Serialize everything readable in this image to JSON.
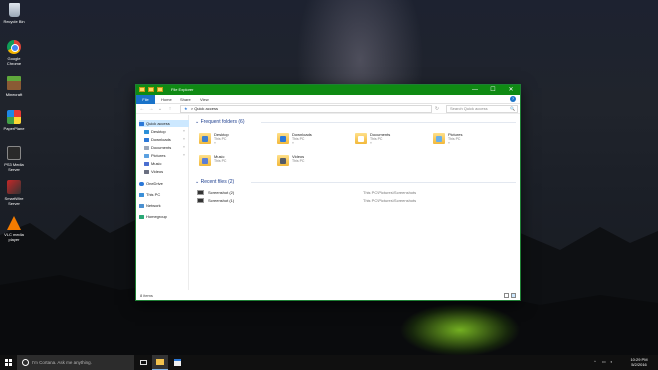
{
  "desktop": {
    "icons": [
      {
        "label": "Recycle Bin",
        "icon": "recycle-bin-icon"
      },
      {
        "label": "Google Chrome",
        "icon": "chrome-icon"
      },
      {
        "label": "Minecraft",
        "icon": "minecraft-icon"
      },
      {
        "label": "PaperPlane",
        "icon": "paperplane-icon"
      },
      {
        "label": "PS3 Media Server",
        "icon": "ps3-media-server-icon"
      },
      {
        "label": "SmartWire Server",
        "icon": "smartwire-icon"
      },
      {
        "label": "VLC media player",
        "icon": "vlc-icon"
      }
    ]
  },
  "window": {
    "title": "File Explorer",
    "controls": {
      "minimize": "—",
      "maximize": "☐",
      "close": "✕"
    },
    "ribbon_tabs": [
      "File",
      "Home",
      "Share",
      "View"
    ],
    "address": {
      "star": "★",
      "separator": ">",
      "path": "Quick access"
    },
    "search": {
      "placeholder": "Search Quick access",
      "icon": "🔍"
    },
    "nav": {
      "quick_access": "Quick access",
      "pinned": [
        {
          "label": "Desktop",
          "color": "#2b8fd8"
        },
        {
          "label": "Downloads",
          "color": "#2b78d8"
        },
        {
          "label": "Documents",
          "color": "#9aa6b8"
        },
        {
          "label": "Pictures",
          "color": "#5aa0e0"
        },
        {
          "label": "Music",
          "color": "#4a6fd0"
        },
        {
          "label": "Videos",
          "color": "#6a6f80"
        }
      ],
      "onedrive": "OneDrive",
      "this_pc": "This PC",
      "network": "Network",
      "homegroup": "Homegroup"
    },
    "frequent": {
      "header": "Frequent folders (6)",
      "folders": [
        {
          "name": "Desktop",
          "location": "This PC",
          "badge": "#3f7fd0"
        },
        {
          "name": "Downloads",
          "location": "This PC",
          "badge": "#2b78d8"
        },
        {
          "name": "Documents",
          "location": "This PC",
          "badge": "#ffffff"
        },
        {
          "name": "Pictures",
          "location": "This PC",
          "badge": "#6bb0e8"
        },
        {
          "name": "Music",
          "location": "This PC",
          "badge": "#5b7ed6"
        },
        {
          "name": "Videos",
          "location": "This PC",
          "badge": "#555b66"
        }
      ]
    },
    "recent": {
      "header": "Recent files (2)",
      "files": [
        {
          "name": "Screenshot (2)",
          "path": "This PC\\Pictures\\Screenshots"
        },
        {
          "name": "Screenshot (1)",
          "path": "This PC\\Pictures\\Screenshots"
        }
      ]
    },
    "status": "8 items"
  },
  "taskbar": {
    "search_placeholder": "I'm Cortana. Ask me anything.",
    "time": "10:29 PM",
    "date": "5/2/2016"
  }
}
